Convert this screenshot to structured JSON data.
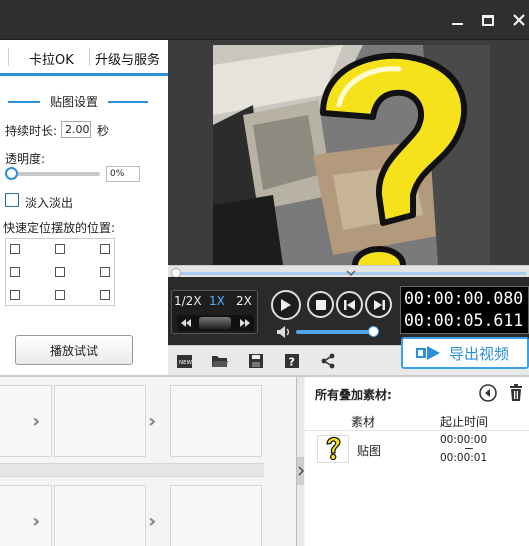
{
  "tabs": [
    "卡拉OK",
    "升级与服务"
  ],
  "settings": {
    "section_title": "贴图设置",
    "duration_label": "持续时长:",
    "duration_value": "2.00",
    "duration_unit": "秒",
    "opacity_label": "透明度:",
    "opacity_value": "0%",
    "opacity_level": 0,
    "fade_label": "淡入淡出",
    "fade_checked": false,
    "position_label": "快速定位摆放的位置:",
    "play_label": "播放试试"
  },
  "player": {
    "speeds": [
      "1/2X",
      "1X",
      "2X"
    ],
    "active_speed": "1X",
    "current_time": "00:00:00.080",
    "total_time": "00:00:05.611",
    "volume_level": 0.95,
    "progress_level": 0.0
  },
  "toolbar": {
    "export_label": "导出视频",
    "icons": [
      "new-icon",
      "open-folder-icon",
      "save-icon",
      "help-icon",
      "share-icon"
    ]
  },
  "material_panel": {
    "title": "所有叠加素材:",
    "col_material": "素材",
    "col_time": "起止时间",
    "rows": [
      {
        "name": "贴图",
        "start": "00:00:00",
        "end": "00:00:01"
      }
    ]
  },
  "colors": {
    "accent": "#2b8fd9",
    "title_bar": "#303030",
    "control_bg": "#2a2a2a",
    "timecode_bg": "#000000",
    "sticker_yellow": "#f5e21a"
  }
}
